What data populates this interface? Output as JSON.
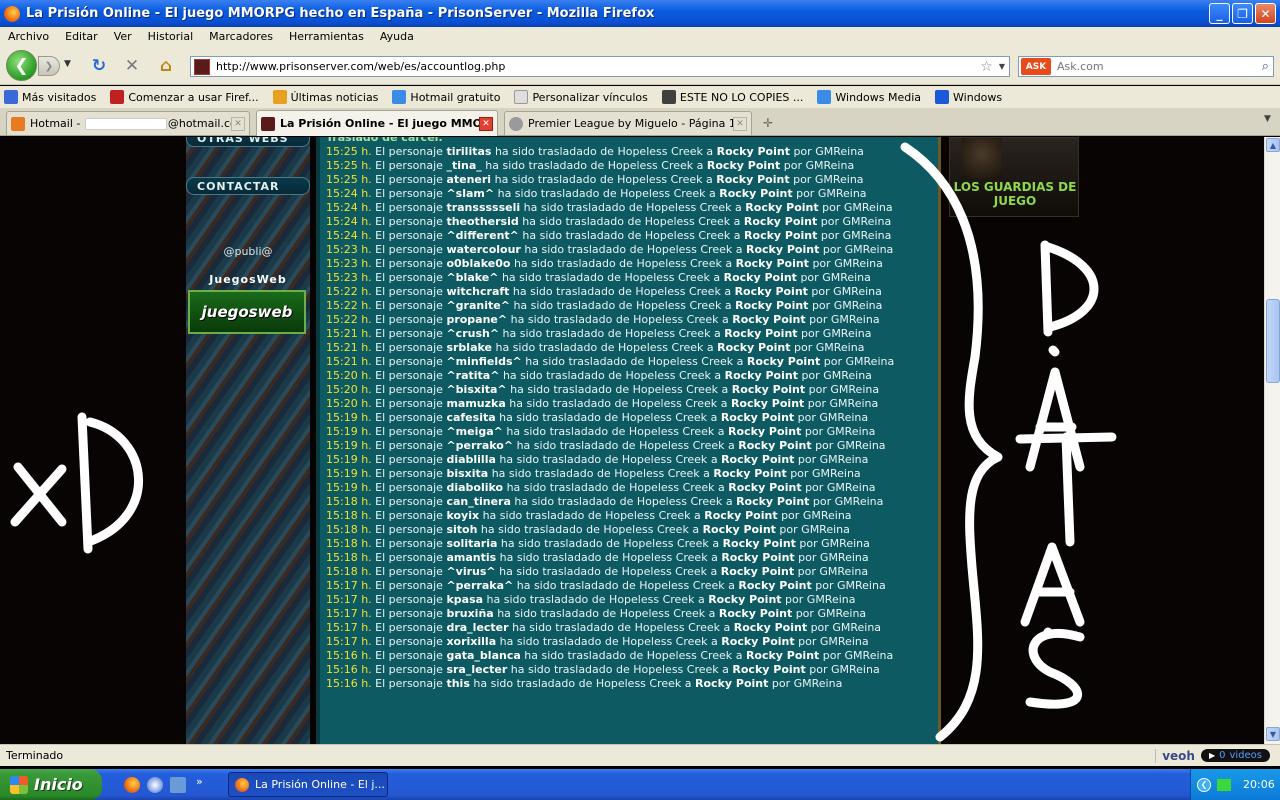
{
  "window": {
    "title": "La Prisión Online - El juego MMORPG hecho en España - PrisonServer - Mozilla Firefox"
  },
  "menu": [
    "Archivo",
    "Editar",
    "Ver",
    "Historial",
    "Marcadores",
    "Herramientas",
    "Ayuda"
  ],
  "nav": {
    "url": "http://www.prisonserver.com/web/es/accountlog.php",
    "search_placeholder": "Ask.com",
    "search_engine": "ASK"
  },
  "bookmarks": [
    {
      "label": "Más visitados",
      "color": "#3a6ad8"
    },
    {
      "label": "Comenzar a usar Firef...",
      "color": "#c02020"
    },
    {
      "label": "Últimas noticias",
      "color": "#e8a020"
    },
    {
      "label": "Hotmail gratuito",
      "color": "#3a8ae8"
    },
    {
      "label": "Personalizar vínculos",
      "color": "#dedede"
    },
    {
      "label": "ESTE NO LO COPIES ...",
      "color": "#404040"
    },
    {
      "label": "Windows Media",
      "color": "#3a8ae8"
    },
    {
      "label": "Windows",
      "color": "#1a5ad8"
    }
  ],
  "tabs": [
    {
      "prefix": "Hotmail - ",
      "suffix": "@hotmail.co...",
      "active": false
    },
    {
      "label": "La Prisión Online - El juego MMOR...",
      "active": true
    },
    {
      "label": "Premier League by Miguelo - Página 14 ...",
      "active": false
    }
  ],
  "sidebar": {
    "section_top": "OTRAS WEBS",
    "section_contact": "CONTACTAR",
    "publi": "@publi@",
    "juegosweb_title": "JuegosWeb",
    "juegosweb_logo": "juegosweb"
  },
  "log": {
    "header": "Traslado de carcel:",
    "connector": "ha sido trasladado de",
    "from": "Hopeless Creek",
    "to_word": "a",
    "to": "Rocky Point",
    "by_word": "por",
    "by": "GMReina",
    "subject_word": "El personaje",
    "entries": [
      {
        "time": "15:25 h.",
        "name": "tirilitas"
      },
      {
        "time": "15:25 h.",
        "name": "_tina_"
      },
      {
        "time": "15:25 h.",
        "name": "ateneri"
      },
      {
        "time": "15:24 h.",
        "name": "^slam^"
      },
      {
        "time": "15:24 h.",
        "name": "transsssseli"
      },
      {
        "time": "15:24 h.",
        "name": "theothersid"
      },
      {
        "time": "15:24 h.",
        "name": "^different^"
      },
      {
        "time": "15:23 h.",
        "name": "watercolour"
      },
      {
        "time": "15:23 h.",
        "name": "o0blake0o"
      },
      {
        "time": "15:23 h.",
        "name": "^blake^"
      },
      {
        "time": "15:22 h.",
        "name": "witchcraft"
      },
      {
        "time": "15:22 h.",
        "name": "^granite^"
      },
      {
        "time": "15:22 h.",
        "name": "propane^"
      },
      {
        "time": "15:21 h.",
        "name": "^crush^"
      },
      {
        "time": "15:21 h.",
        "name": "srblake"
      },
      {
        "time": "15:21 h.",
        "name": "^minfields^"
      },
      {
        "time": "15:20 h.",
        "name": "^ratita^"
      },
      {
        "time": "15:20 h.",
        "name": "^bisxita^"
      },
      {
        "time": "15:20 h.",
        "name": "mamuzka"
      },
      {
        "time": "15:19 h.",
        "name": "cafesita"
      },
      {
        "time": "15:19 h.",
        "name": "^meiga^"
      },
      {
        "time": "15:19 h.",
        "name": "^perrako^"
      },
      {
        "time": "15:19 h.",
        "name": "diablilla"
      },
      {
        "time": "15:19 h.",
        "name": "bisxita"
      },
      {
        "time": "15:19 h.",
        "name": "diaboliko"
      },
      {
        "time": "15:18 h.",
        "name": "can_tinera"
      },
      {
        "time": "15:18 h.",
        "name": "koyix"
      },
      {
        "time": "15:18 h.",
        "name": "sitoh"
      },
      {
        "time": "15:18 h.",
        "name": "solitaria"
      },
      {
        "time": "15:18 h.",
        "name": "amantis"
      },
      {
        "time": "15:18 h.",
        "name": "^virus^"
      },
      {
        "time": "15:17 h.",
        "name": "^perraka^"
      },
      {
        "time": "15:17 h.",
        "name": "kpasa"
      },
      {
        "time": "15:17 h.",
        "name": "bruxiña"
      },
      {
        "time": "15:17 h.",
        "name": "dra_lecter"
      },
      {
        "time": "15:17 h.",
        "name": "xorixilla"
      },
      {
        "time": "15:16 h.",
        "name": "gata_blanca"
      },
      {
        "time": "15:16 h.",
        "name": "sra_lecter"
      },
      {
        "time": "15:16 h.",
        "name": "this"
      }
    ]
  },
  "right_panel": {
    "label": "LOS GUARDIAS DE JUEGO"
  },
  "status": {
    "text": "Terminado",
    "veoh_logo": "veoh",
    "veoh_count": "0",
    "veoh_videos": "videos"
  },
  "taskbar": {
    "start": "Inicio",
    "task": "La Prisión Online - El j...",
    "clock": "20:06"
  },
  "colors": {
    "log_bg": "#0e5a62",
    "time": "#f0e030",
    "highlight": "#8ed84a"
  }
}
